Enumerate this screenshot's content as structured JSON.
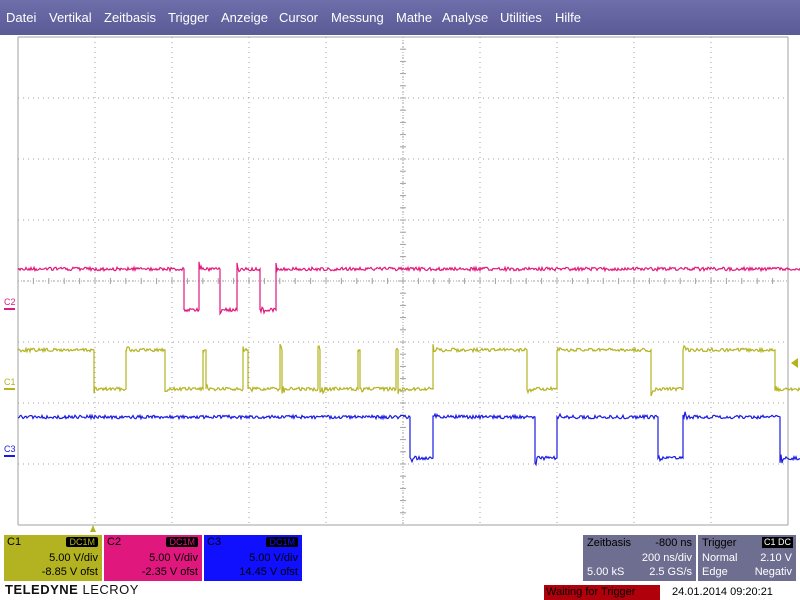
{
  "menu": [
    "Datei",
    "Vertikal",
    "Zeitbasis",
    "Trigger",
    "Anzeige",
    "Cursor",
    "Messung",
    "Mathe",
    "Analyse",
    "Utilities",
    "Hilfe"
  ],
  "colors": {
    "menubar": "#5a5a95",
    "grid": "#a0a0a0",
    "c1": "#b3b321",
    "c2": "#e0187e",
    "c3": "#1a1ae0",
    "panel": "#6e6e90",
    "status_bg": "#b0000b"
  },
  "traces": {
    "c1": {
      "label": "C1"
    },
    "c2": {
      "label": "C2"
    },
    "c3": {
      "label": "C3"
    }
  },
  "channels": [
    {
      "name": "C1",
      "coupling": "DC1M",
      "scale": "5.00 V/div",
      "offset": "-8.85 V ofst",
      "bg": "#b3b321",
      "headbg": "#b3b321",
      "fg": "#000000"
    },
    {
      "name": "C2",
      "coupling": "DC1M",
      "scale": "5.00 V/div",
      "offset": "-2.35 V ofst",
      "bg": "#e0187e",
      "headbg": "#e0187e",
      "fg": "#000000"
    },
    {
      "name": "C3",
      "coupling": "DC1M",
      "scale": "5.00 V/div",
      "offset": "14.45 V ofst",
      "bg": "#1010ff",
      "headbg": "#1010ff",
      "fg": "#000000"
    }
  ],
  "timebase": {
    "label": "Zeitbasis",
    "delay": "-800 ns",
    "per_div": "200 ns/div",
    "samples": "5.00 kS",
    "rate": "2.5 GS/s"
  },
  "trigger": {
    "label": "Trigger",
    "source": "C1 DC",
    "mode": "Normal",
    "level": "2.10 V",
    "type": "Edge",
    "slope": "Negativ"
  },
  "logo": {
    "bold": "TELEDYNE",
    "thin": "LECROY"
  },
  "status": "Waiting for Trigger",
  "datetime": "24.01.2014 09:20:21"
}
